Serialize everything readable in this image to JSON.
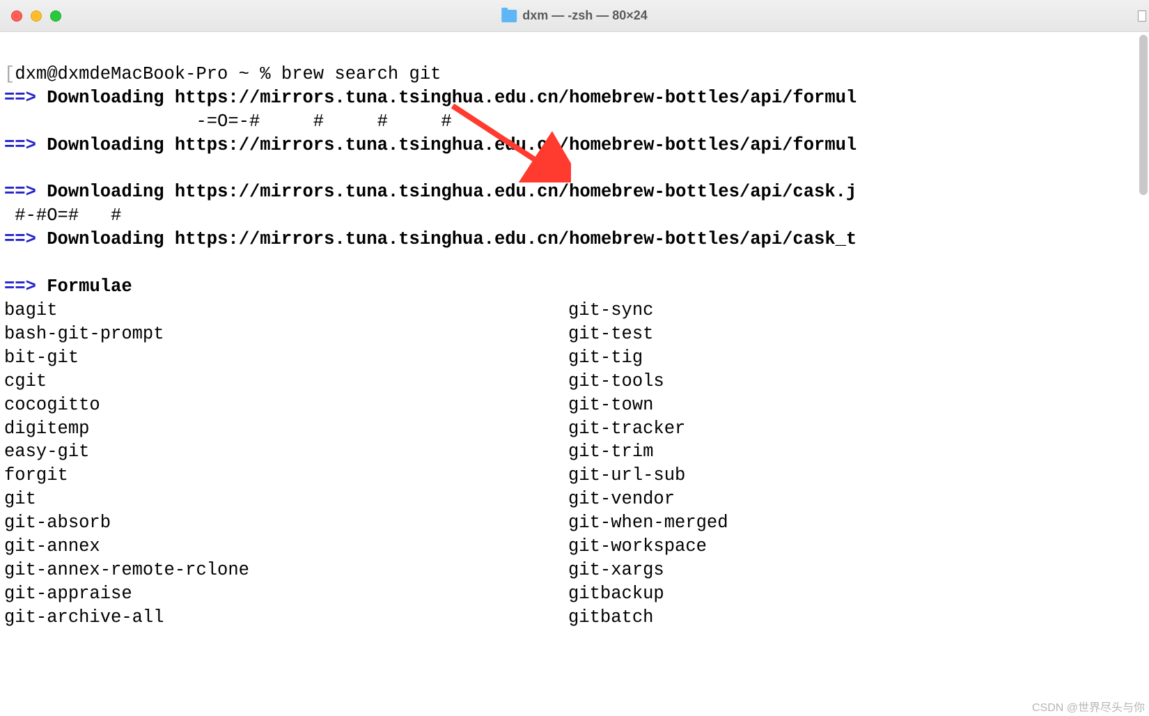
{
  "titlebar": {
    "title": "dxm — -zsh — 80×24"
  },
  "prompt": {
    "open_bracket": "[",
    "user_host": "dxm@dxmdeMacBook-Pro",
    "path_sep": " ~ % ",
    "command": "brew search git"
  },
  "downloads": [
    {
      "arrow": "==>",
      "label": "Downloading",
      "url": "https://mirrors.tuna.tsinghua.edu.cn/homebrew-bottles/api/formul",
      "progress": "                  -=O=-#     #     #     #"
    },
    {
      "arrow": "==>",
      "label": "Downloading",
      "url": "https://mirrors.tuna.tsinghua.edu.cn/homebrew-bottles/api/formul",
      "progress": ""
    },
    {
      "arrow": "==>",
      "label": "Downloading",
      "url": "https://mirrors.tuna.tsinghua.edu.cn/homebrew-bottles/api/cask.j",
      "progress": " #-#O=#   #"
    },
    {
      "arrow": "==>",
      "label": "Downloading",
      "url": "https://mirrors.tuna.tsinghua.edu.cn/homebrew-bottles/api/cask_t",
      "progress": ""
    }
  ],
  "section": {
    "arrow": "==>",
    "heading": "Formulae"
  },
  "formulae_left": [
    "bagit",
    "bash-git-prompt",
    "bit-git",
    "cgit",
    "cocogitto",
    "digitemp",
    "easy-git",
    "forgit",
    "git",
    "git-absorb",
    "git-annex",
    "git-annex-remote-rclone",
    "git-appraise",
    "git-archive-all"
  ],
  "formulae_right": [
    "git-sync",
    "git-test",
    "git-tig",
    "git-tools",
    "git-town",
    "git-tracker",
    "git-trim",
    "git-url-sub",
    "git-vendor",
    "git-when-merged",
    "git-workspace",
    "git-xargs",
    "gitbackup",
    "gitbatch"
  ],
  "watermark": "CSDN @世界尽头与你"
}
